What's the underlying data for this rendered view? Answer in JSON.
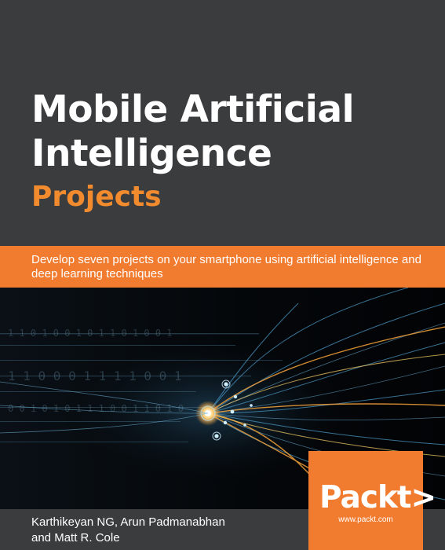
{
  "book": {
    "title_line1": "Mobile Artificial",
    "title_line2": "Intelligence",
    "title_line3": "Projects",
    "tagline": "Develop seven projects on your smartphone using artificial intelligence and deep learning techniques",
    "authors_line1": "Karthikeyan NG, Arun Padmanabhan",
    "authors_line2": "and Matt R. Cole"
  },
  "publisher": {
    "logo_text": "Packt>",
    "url": "www.packt.com"
  },
  "colors": {
    "background": "#3b3c3e",
    "accent_orange": "#f17b2f",
    "subtitle_orange": "#f28a2e",
    "art_background": "#06090c"
  },
  "art": {
    "description_icon": "neural-network-illustration"
  }
}
